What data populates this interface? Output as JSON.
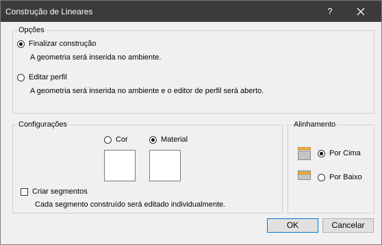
{
  "window": {
    "title": "Construção de Lineares",
    "help": "?"
  },
  "options": {
    "legend": "Opções",
    "finalize": {
      "label": "Finalizar construção",
      "description": "A geometria será inserida no ambiente.",
      "checked": true
    },
    "edit": {
      "label": "Editar perfil",
      "description": "A geometria será inserida no ambiente e o editor de perfil será aberto.",
      "checked": false
    }
  },
  "settings": {
    "legend": "Configurações",
    "color": {
      "label": "Cor",
      "checked": false
    },
    "material": {
      "label": "Material",
      "checked": true
    },
    "segments": {
      "label": "Criar segmentos",
      "description": "Cada segmento construído será editado individualmente.",
      "checked": false
    }
  },
  "alignment": {
    "legend": "Alinhamento",
    "top": {
      "label": "Por Cima",
      "checked": true,
      "icon": "align-top-icon"
    },
    "bottom": {
      "label": "Por Baixo",
      "checked": false,
      "icon": "align-bottom-icon"
    }
  },
  "buttons": {
    "ok": "OK",
    "cancel": "Cancelar"
  },
  "colors": {
    "titlebar": "#3b3b3b",
    "dialog_bg": "#f0f0f0",
    "accent": "#0078d7",
    "align_bar": "#f5b342"
  }
}
